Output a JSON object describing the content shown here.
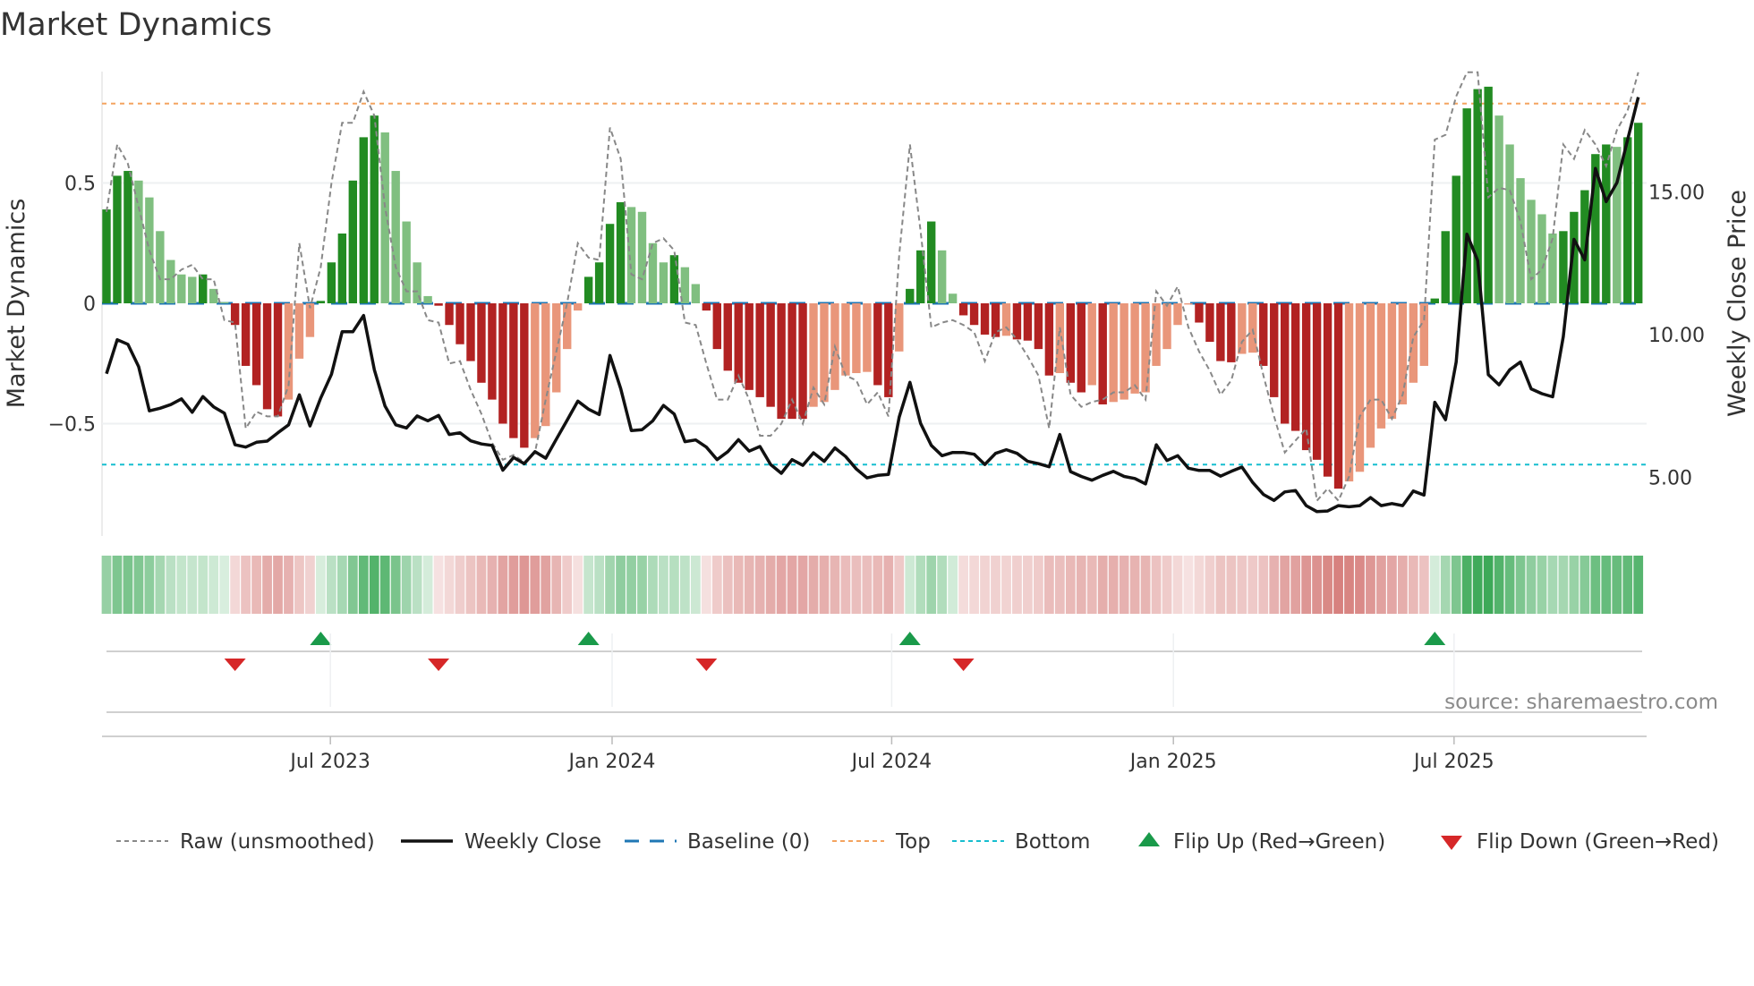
{
  "title": "Market Dynamics",
  "source": "source: sharemaestro.com",
  "colors": {
    "bar_up_strong": "#228b22",
    "bar_up_weak": "#80bf80",
    "bar_down_strong": "#b22222",
    "bar_down_weak": "#e9967a",
    "raw": "#888888",
    "close": "#111111",
    "baseline": "#1f77b4",
    "top": "#f4a460",
    "bottom": "#17becf",
    "flip_up": "#1a9a4a",
    "flip_down": "#d62728"
  },
  "chart_data": {
    "type": "bar",
    "title": "Market Dynamics",
    "ylabel": "Market Dynamics",
    "y2label": "Weekly Close Price",
    "ylim": [
      -0.97,
      0.96
    ],
    "y2lim": [
      3.0,
      19.0
    ],
    "yticks": [
      {
        "v": 0.5,
        "label": "0.5"
      },
      {
        "v": 0,
        "label": "0"
      },
      {
        "v": -0.5,
        "label": "−0.5"
      }
    ],
    "y2ticks": [
      {
        "v": 15,
        "label": "15.00"
      },
      {
        "v": 10,
        "label": "10.00"
      },
      {
        "v": 5,
        "label": "5.00"
      }
    ],
    "xticks": [
      {
        "week": 20.9,
        "label": "Jul 2023"
      },
      {
        "week": 47.2,
        "label": "Jan 2024"
      },
      {
        "week": 73.3,
        "label": "Jul 2024"
      },
      {
        "week": 99.6,
        "label": "Jan 2025"
      },
      {
        "week": 125.8,
        "label": "Jul 2025"
      }
    ],
    "top_level": 0.83,
    "bottom_level": -0.67,
    "baseline": 0,
    "grid": true,
    "legend_position": "bottom",
    "legend": [
      "Raw (unsmoothed)",
      "Weekly Close",
      "Baseline (0)",
      "Top",
      "Bottom",
      "Flip Up (Red→Green)",
      "Flip Down (Green→Red)"
    ],
    "dynamics": [
      0.39,
      0.53,
      0.55,
      0.51,
      0.44,
      0.3,
      0.18,
      0.12,
      0.11,
      0.12,
      0.06,
      0.005,
      -0.09,
      -0.26,
      -0.34,
      -0.44,
      -0.47,
      -0.4,
      -0.23,
      -0.14,
      0.01,
      0.17,
      0.29,
      0.51,
      0.69,
      0.78,
      0.71,
      0.55,
      0.34,
      0.17,
      0.03,
      -0.01,
      -0.09,
      -0.17,
      -0.24,
      -0.33,
      -0.4,
      -0.5,
      -0.56,
      -0.6,
      -0.56,
      -0.51,
      -0.37,
      -0.19,
      -0.03,
      0.11,
      0.17,
      0.33,
      0.42,
      0.4,
      0.38,
      0.25,
      0.17,
      0.2,
      0.15,
      0.08,
      -0.03,
      -0.19,
      -0.28,
      -0.33,
      -0.36,
      -0.39,
      -0.43,
      -0.48,
      -0.48,
      -0.48,
      -0.43,
      -0.41,
      -0.36,
      -0.3,
      -0.29,
      -0.285,
      -0.34,
      -0.39,
      -0.2,
      0.06,
      0.22,
      0.34,
      0.22,
      0.04,
      -0.05,
      -0.09,
      -0.13,
      -0.14,
      -0.135,
      -0.15,
      -0.155,
      -0.19,
      -0.3,
      -0.29,
      -0.33,
      -0.37,
      -0.34,
      -0.42,
      -0.41,
      -0.4,
      -0.375,
      -0.37,
      -0.26,
      -0.19,
      -0.09,
      -0.005,
      -0.08,
      -0.16,
      -0.24,
      -0.245,
      -0.21,
      -0.205,
      -0.26,
      -0.39,
      -0.5,
      -0.53,
      -0.61,
      -0.65,
      -0.72,
      -0.77,
      -0.74,
      -0.7,
      -0.6,
      -0.52,
      -0.48,
      -0.42,
      -0.33,
      -0.26,
      0.02,
      0.3,
      0.53,
      0.81,
      0.89,
      0.9,
      0.78,
      0.66,
      0.52,
      0.43,
      0.37,
      0.29,
      0.3,
      0.38,
      0.47,
      0.62,
      0.66,
      0.65,
      0.69,
      0.75
    ],
    "raw": [
      0.38,
      0.66,
      0.58,
      0.4,
      0.22,
      0.1,
      0.1,
      0.14,
      0.16,
      0.1,
      0.1,
      -0.07,
      -0.08,
      -0.52,
      -0.45,
      -0.47,
      -0.47,
      -0.34,
      0.25,
      -0.02,
      0.15,
      0.5,
      0.75,
      0.75,
      0.88,
      0.78,
      0.4,
      0.15,
      0.05,
      0.05,
      -0.07,
      -0.08,
      -0.25,
      -0.24,
      -0.36,
      -0.46,
      -0.58,
      -0.65,
      -0.63,
      -0.66,
      -0.62,
      -0.4,
      -0.2,
      0.0,
      0.25,
      0.19,
      0.18,
      0.73,
      0.6,
      0.12,
      0.1,
      0.25,
      0.27,
      0.22,
      -0.08,
      -0.09,
      -0.25,
      -0.4,
      -0.4,
      -0.3,
      -0.4,
      -0.55,
      -0.55,
      -0.5,
      -0.4,
      -0.5,
      -0.35,
      -0.42,
      -0.18,
      -0.3,
      -0.32,
      -0.42,
      -0.37,
      -0.47,
      0.2,
      0.66,
      0.3,
      -0.1,
      -0.08,
      -0.07,
      -0.09,
      -0.12,
      -0.24,
      -0.12,
      -0.1,
      -0.15,
      -0.22,
      -0.3,
      -0.52,
      -0.1,
      -0.38,
      -0.43,
      -0.41,
      -0.4,
      -0.37,
      -0.37,
      -0.34,
      -0.4,
      0.05,
      -0.01,
      0.07,
      -0.1,
      -0.2,
      -0.28,
      -0.38,
      -0.32,
      -0.16,
      -0.11,
      -0.3,
      -0.47,
      -0.62,
      -0.57,
      -0.52,
      -0.82,
      -0.77,
      -0.82,
      -0.72,
      -0.47,
      -0.4,
      -0.4,
      -0.48,
      -0.38,
      -0.14,
      -0.07,
      0.68,
      0.7,
      0.86,
      0.96,
      0.96,
      0.44,
      0.48,
      0.47,
      0.34,
      0.1,
      0.14,
      0.27,
      0.66,
      0.6,
      0.72,
      0.66,
      0.57,
      0.72,
      0.8,
      0.96
    ],
    "close": [
      8.63,
      9.82,
      9.66,
      8.88,
      7.33,
      7.42,
      7.55,
      7.75,
      7.28,
      7.83,
      7.47,
      7.25,
      6.14,
      6.06,
      6.23,
      6.27,
      6.56,
      6.84,
      7.89,
      6.8,
      7.78,
      8.61,
      10.1,
      10.1,
      10.67,
      8.77,
      7.5,
      6.84,
      6.73,
      7.15,
      6.98,
      7.17,
      6.5,
      6.56,
      6.28,
      6.17,
      6.12,
      5.25,
      5.7,
      5.48,
      5.9,
      5.67,
      6.34,
      7.0,
      7.67,
      7.39,
      7.2,
      9.27,
      8.11,
      6.64,
      6.67,
      6.98,
      7.52,
      7.22,
      6.25,
      6.31,
      6.06,
      5.62,
      5.9,
      6.32,
      5.92,
      6.08,
      5.45,
      5.14,
      5.62,
      5.42,
      5.86,
      5.56,
      6.03,
      5.73,
      5.29,
      4.98,
      5.07,
      5.1,
      7.11,
      8.33,
      6.89,
      6.12,
      5.76,
      5.87,
      5.87,
      5.81,
      5.45,
      5.84,
      5.97,
      5.84,
      5.56,
      5.48,
      5.37,
      6.5,
      5.2,
      5.03,
      4.9,
      5.07,
      5.21,
      5.03,
      4.96,
      4.77,
      6.14,
      5.59,
      5.76,
      5.32,
      5.24,
      5.24,
      5.04,
      5.21,
      5.36,
      4.82,
      4.4,
      4.19,
      4.49,
      4.54,
      4.01,
      3.8,
      3.82,
      4.01,
      3.97,
      4.01,
      4.29,
      4.01,
      4.08,
      4.01,
      4.52,
      4.38,
      7.63,
      7.02,
      9.04,
      13.52,
      12.6,
      8.6,
      8.24,
      8.77,
      9.04,
      8.1,
      7.93,
      7.82,
      9.93,
      13.34,
      12.62,
      15.82,
      14.66,
      15.32,
      16.82,
      18.32
    ],
    "flip_up_weeks": [
      20,
      45,
      75,
      124
    ],
    "flip_down_weeks": [
      12,
      31,
      56,
      80
    ]
  }
}
